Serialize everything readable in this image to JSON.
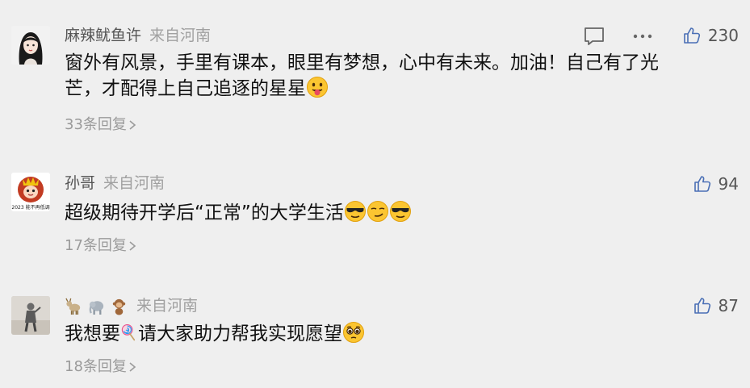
{
  "comments": [
    {
      "name": "麻辣鱿鱼许",
      "location": "来自河南",
      "text_line1": "窗外有风景，手里有课本，眼里有梦想，心中有未来。加油！自己有了光",
      "text_line2": "芒，才配得上自己追逐的星星",
      "emoji": "tongue-face-emoji",
      "likes": "230",
      "replies": "33条回复"
    },
    {
      "name": "孙哥",
      "location": "来自河南",
      "text": "超级期待开学后“正常”的大学生活",
      "emoji": [
        "sunglasses-emoji",
        "smirk-emoji",
        "sunglasses-emoji"
      ],
      "likes": "94",
      "replies": "17条回复",
      "avatar_caption": "2023 能不再低调"
    },
    {
      "name_icons": [
        "goat-emoji",
        "elephant-emoji",
        "monkey-emoji"
      ],
      "location": "来自河南",
      "text_before": "我想要",
      "text_after": "请大家助力帮我实现愿望",
      "emoji": [
        "lollipop-emoji",
        "pleading-face-emoji"
      ],
      "likes": "87",
      "replies": "18条回复"
    }
  ],
  "colors": {
    "background": "#efefef",
    "text": "#111111",
    "meta": "#555555",
    "muted": "#a0a0a0"
  }
}
